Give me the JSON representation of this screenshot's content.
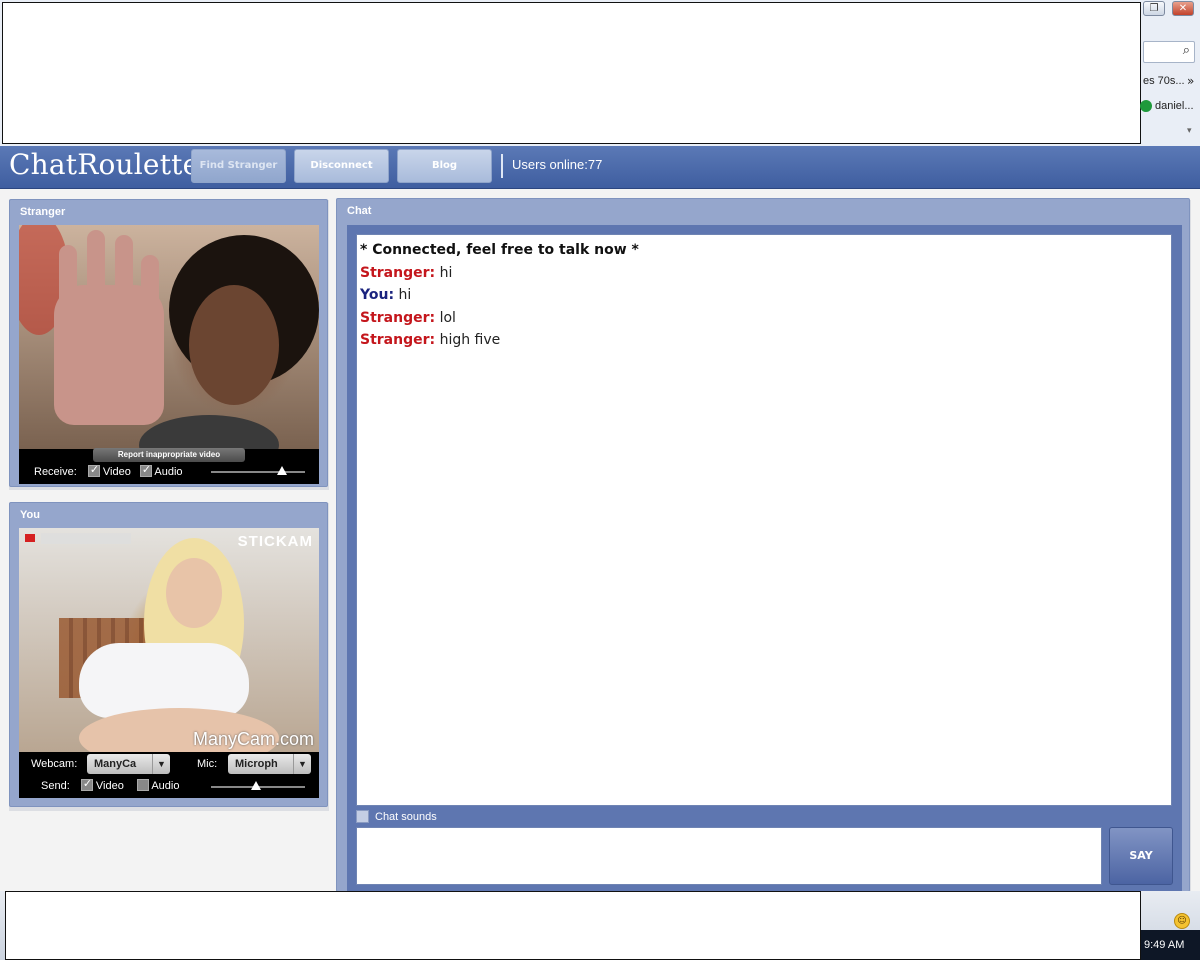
{
  "chrome": {
    "favorites_text": "es 70s...",
    "chevron": "»",
    "user_label": "daniel...",
    "search_icon": "search-icon"
  },
  "header": {
    "logo": "ChatRoulette",
    "find_stranger": "Find Stranger",
    "disconnect": "Disconnect",
    "blog": "Blog",
    "users_online": "Users online:77"
  },
  "stranger_panel": {
    "title": "Stranger",
    "report_button": "Report inappropriate video",
    "receive_label": "Receive:",
    "video_label": "Video",
    "audio_label": "Audio",
    "video_checked": true,
    "audio_checked": true,
    "volume_level": 0.75
  },
  "you_panel": {
    "title": "You",
    "watermark_top": "STICKAM",
    "watermark_bottom": "ManyCam.com",
    "webcam_label": "Webcam:",
    "webcam_value": "ManyCa",
    "mic_label": "Mic:",
    "mic_value": "Microph",
    "send_label": "Send:",
    "video_label": "Video",
    "audio_label": "Audio",
    "video_checked": true,
    "audio_checked": false,
    "volume_level": 0.48
  },
  "chat": {
    "title": "Chat",
    "system_message": "* Connected, feel free to talk now *",
    "messages": [
      {
        "who": "Stranger:",
        "text": "hi"
      },
      {
        "who": "You:",
        "text": "hi"
      },
      {
        "who": "Stranger:",
        "text": "lol"
      },
      {
        "who": "Stranger:",
        "text": "high five"
      }
    ],
    "chat_sounds_label": "Chat sounds",
    "input_value": "",
    "say_button": "SAY"
  },
  "taskbar": {
    "clock": "9:49 AM"
  },
  "colors": {
    "header_bg": "#4a68aa",
    "panel_bg": "#95a6cc",
    "stranger_name": "#c4161c",
    "you_name": "#1a237e"
  }
}
